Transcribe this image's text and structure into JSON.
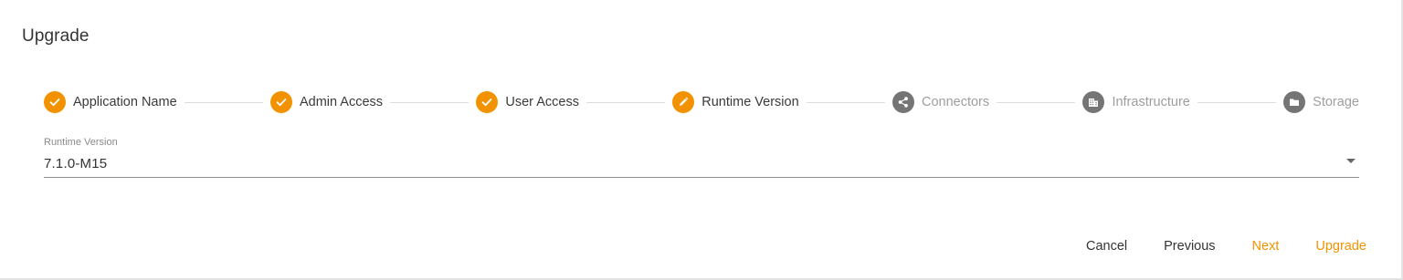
{
  "dialog": {
    "title": "Upgrade"
  },
  "colors": {
    "accent": "#f39200",
    "inactive": "#757575"
  },
  "stepper": {
    "steps": [
      {
        "label": "Application Name",
        "state": "done",
        "icon": "check-icon"
      },
      {
        "label": "Admin Access",
        "state": "done",
        "icon": "check-icon"
      },
      {
        "label": "User Access",
        "state": "done",
        "icon": "check-icon"
      },
      {
        "label": "Runtime Version",
        "state": "active",
        "icon": "pencil-icon"
      },
      {
        "label": "Connectors",
        "state": "todo",
        "icon": "share-icon"
      },
      {
        "label": "Infrastructure",
        "state": "todo",
        "icon": "building-icon"
      },
      {
        "label": "Storage",
        "state": "todo",
        "icon": "folder-icon"
      }
    ]
  },
  "runtime_field": {
    "label": "Runtime Version",
    "value": "7.1.0-M15"
  },
  "actions": {
    "cancel": "Cancel",
    "previous": "Previous",
    "next": "Next",
    "upgrade": "Upgrade"
  }
}
